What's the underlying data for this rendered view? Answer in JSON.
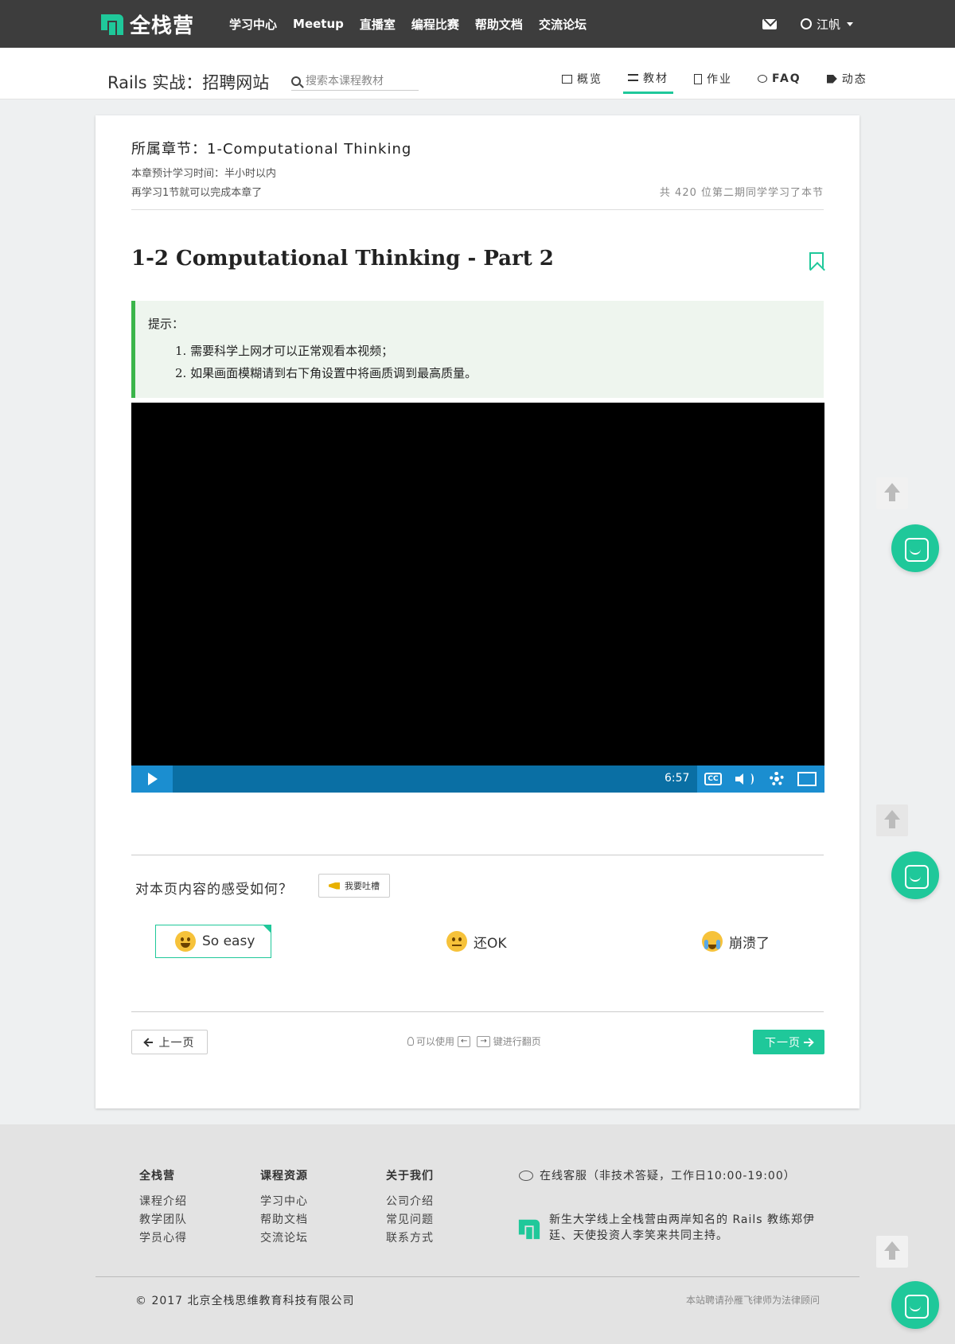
{
  "brand": {
    "name": "全栈营",
    "accent": "#1fc89a"
  },
  "nav": {
    "links": [
      "学习中心",
      "Meetup",
      "直播室",
      "编程比赛",
      "帮助文档",
      "交流论坛"
    ],
    "user_name": "江帆"
  },
  "course": {
    "title": "Rails 实战：招聘网站",
    "search_placeholder": "搜索本课程教材",
    "tabs": [
      {
        "label": "概览",
        "icon": "monitor-icon",
        "active": false
      },
      {
        "label": "教材",
        "icon": "list-icon",
        "active": true
      },
      {
        "label": "作业",
        "icon": "code-file-icon",
        "active": false
      },
      {
        "label": "FAQ",
        "icon": "comments-icon",
        "active": false
      },
      {
        "label": "动态",
        "icon": "tags-icon",
        "active": false
      }
    ]
  },
  "lesson": {
    "chapter": "所属章节：1-Computational Thinking",
    "est_time": "本章预计学习时间：半小时以内",
    "remaining": "再学习1节就可以完成本章了",
    "learners": "共 420 位第二期同学学习了本节",
    "title": "1-2 Computational Thinking - Part 2",
    "tip_label": "提示：",
    "tips": [
      "1. 需要科学上网才可以正常观看本视频；",
      "2. 如果画面模糊请到右下角设置中将画质调到最高质量。"
    ]
  },
  "video": {
    "time": "6:57",
    "cc_label": "CC"
  },
  "feedback": {
    "question": "对本页内容的感受如何？",
    "complain_label": "我要吐槽",
    "options": [
      {
        "label": "So easy",
        "icon": "grin-emoji-icon",
        "selected": true
      },
      {
        "label": "还OK",
        "icon": "neutral-emoji-icon",
        "selected": false
      },
      {
        "label": "崩溃了",
        "icon": "crying-emoji-icon",
        "selected": false
      }
    ]
  },
  "pager": {
    "prev_label": "上一页",
    "hint_prefix": "可以使用",
    "key_left": "←",
    "key_right": "→",
    "hint_suffix": "键进行翻页",
    "next_label": "下一页"
  },
  "footer": {
    "columns": [
      {
        "heading": "全栈营",
        "links": [
          "课程介绍",
          "教学团队",
          "学员心得"
        ]
      },
      {
        "heading": "课程资源",
        "links": [
          "学习中心",
          "帮助文档",
          "交流论坛"
        ]
      },
      {
        "heading": "关于我们",
        "links": [
          "公司介绍",
          "常见问题",
          "联系方式"
        ]
      }
    ],
    "service": "在线客服（非技术答疑，工作日10:00-19:00）",
    "intro": "新生大学线上全栈营由两岸知名的 Rails 教练郑伊廷、天使投资人李笑来共同主持。",
    "copyright": "© 2017 北京全栈思维教育科技有限公司",
    "legal": "本站聘请孙雁飞律师为法律顾问"
  }
}
